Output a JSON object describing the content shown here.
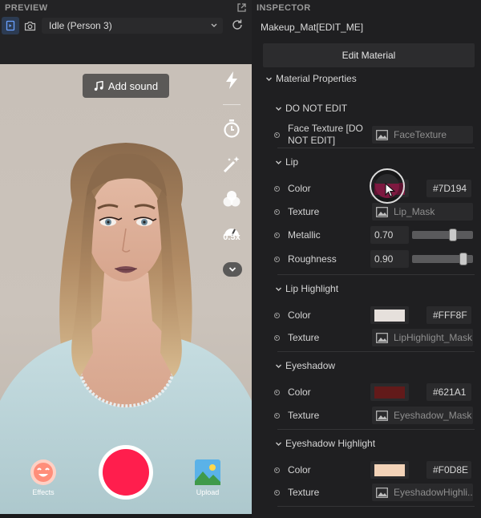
{
  "preview": {
    "title": "PREVIEW",
    "selected_preview": "Idle (Person 3)",
    "add_sound_label": "Add sound",
    "speed_label": "0.5x",
    "effects_label": "Effects",
    "upload_label": "Upload",
    "record_color": "#ff1e4d"
  },
  "inspector": {
    "title": "INSPECTOR",
    "object_name": "Makeup_Mat[EDIT_ME]",
    "edit_button": "Edit Material",
    "material_properties_label": "Material Properties",
    "groups": {
      "do_not_edit": {
        "label": "DO NOT EDIT",
        "face_texture_label": "Face Texture [DO NOT EDIT]",
        "face_texture_value": "FaceTexture"
      },
      "lip": {
        "label": "Lip",
        "color_label": "Color",
        "color_hex": "#7D194",
        "color_swatch": "#7d1940",
        "texture_label": "Texture",
        "texture_value": "Lip_Mask",
        "metallic_label": "Metallic",
        "metallic_value": "0.70",
        "metallic_level": 0.7,
        "roughness_label": "Roughness",
        "roughness_value": "0.90",
        "roughness_level": 0.9
      },
      "lip_highlight": {
        "label": "Lip Highlight",
        "color_label": "Color",
        "color_hex": "#FFF8F",
        "color_swatch": "#e6e0dc",
        "texture_label": "Texture",
        "texture_value": "LipHighlight_Mask"
      },
      "eyeshadow": {
        "label": "Eyeshadow",
        "color_label": "Color",
        "color_hex": "#621A1",
        "color_swatch": "#621a1a",
        "texture_label": "Texture",
        "texture_value": "Eyeshadow_Mask"
      },
      "eyeshadow_highlight": {
        "label": "Eyeshadow Highlight",
        "color_label": "Color",
        "color_hex": "#F0D8E",
        "color_swatch": "#f3d3b8",
        "texture_label": "Texture",
        "texture_value": "EyeshadowHighli..."
      }
    }
  }
}
